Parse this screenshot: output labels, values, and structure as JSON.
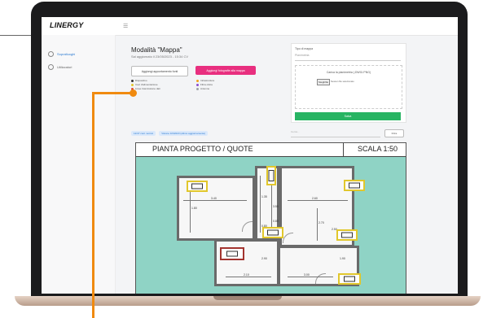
{
  "app": {
    "logo": "LINERGY"
  },
  "sidebar": {
    "items": [
      {
        "label": "Sopralluoghi",
        "active": true
      },
      {
        "label": "Utilizzatori",
        "active": false
      }
    ]
  },
  "main": {
    "title": "Modalità \"Mappa\"",
    "subtitle": "Sal aggiornato il 23/05/2023 - 15:34 CV",
    "buttons": {
      "outline": "Aggiungi appuntamento fonti",
      "pink": "Aggiungi fotografie alla mappa"
    },
    "legend": [
      {
        "label": "Dispositivo",
        "color": "#333333"
      },
      {
        "label": "Cavi d'alimentazione",
        "color": "#e1c72c"
      },
      {
        "label": "Linee trasmissione dati",
        "color": "#e04b2f"
      },
      {
        "label": "Infrastruttura",
        "color": "#f2a31b"
      },
      {
        "label": "Fibra ottica",
        "color": "#8a4bd1"
      },
      {
        "label": "Antenne",
        "color": "#9ea3a8"
      }
    ],
    "tags": [
      "12/47 cont. tecnici",
      "Visione 3/4/2023 (ultimo aggiornamento)"
    ],
    "search_placeholder": "Cerca...",
    "filter_label": "Filtra"
  },
  "upload_panel": {
    "label": "Tipo di mappa",
    "select_placeholder": "Planimetria",
    "title": "Carica la planimetria (.DWG/.PNG)",
    "choose_label": "Scegli file",
    "file_label": "Nessun file selezionato",
    "submit_label": "Salva"
  },
  "plan": {
    "title": "PIANTA PROGETTO / QUOTE",
    "scale": "SCALA 1:50",
    "dims": [
      "3.40",
      "2.60",
      "1.80",
      "1.35",
      "3.55",
      "2.70",
      "2.10",
      "3.00",
      "2.90",
      "0.80",
      "0.80",
      "1.90",
      "2.50"
    ]
  },
  "colors": {
    "accent_pink": "#e82f7f",
    "callout": "#f08a10",
    "device_box": "#e1c72c",
    "device_alert": "#a3342f",
    "plan_bg": "#8fd3c5",
    "save_green": "#28b463"
  }
}
